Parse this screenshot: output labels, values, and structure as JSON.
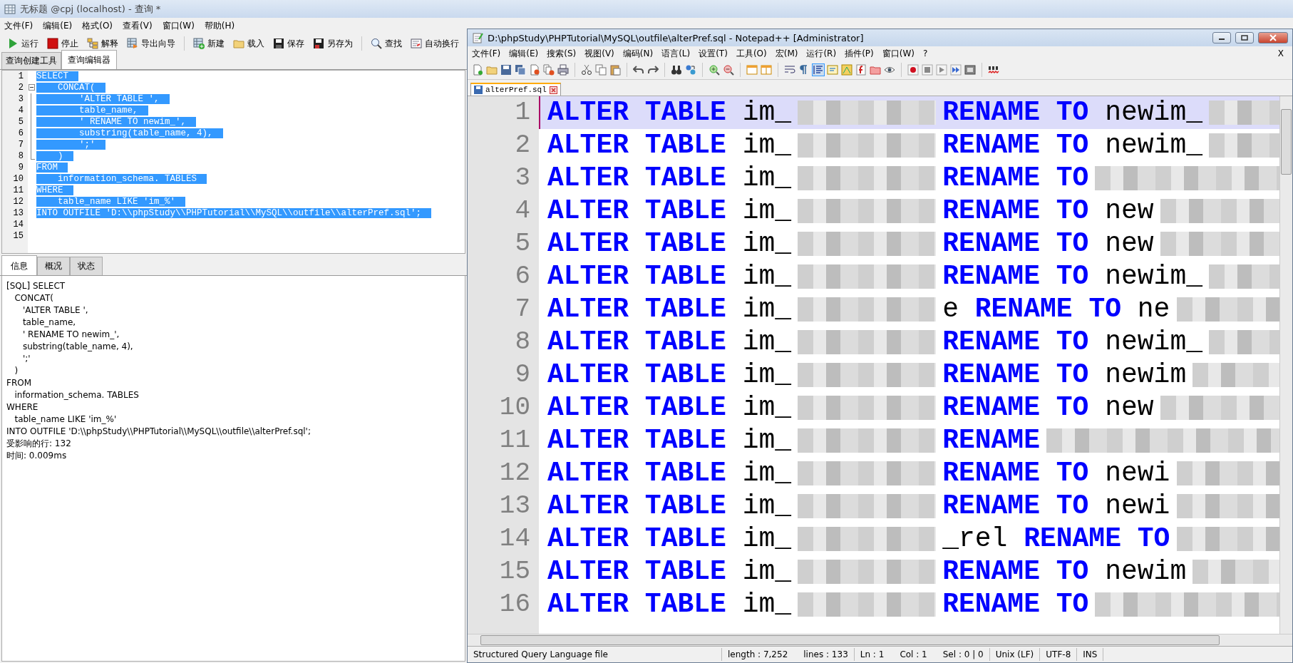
{
  "main_window": {
    "title": "无标题 @cpj (localhost) - 查询 *",
    "menu": [
      "文件(F)",
      "编辑(E)",
      "格式(O)",
      "查看(V)",
      "窗口(W)",
      "帮助(H)"
    ],
    "toolbar": [
      [
        {
          "label": "运行"
        },
        {
          "label": "停止"
        },
        {
          "label": "解释"
        },
        {
          "label": "导出向导"
        }
      ],
      [
        {
          "label": "新建"
        },
        {
          "label": "载入"
        },
        {
          "label": "保存"
        },
        {
          "label": "另存为"
        }
      ],
      [
        {
          "label": "查找"
        },
        {
          "label": "自动换行"
        }
      ]
    ],
    "tabs": [
      {
        "label": "查询创建工具",
        "selected": false
      },
      {
        "label": "查询编辑器",
        "selected": true
      }
    ],
    "editor": {
      "lines": [
        {
          "number": "1",
          "text": "SELECT",
          "selected": true,
          "kind": "plain"
        },
        {
          "number": "2",
          "text": "    CONCAT(",
          "selected": true,
          "kind": "fold_start"
        },
        {
          "number": "3",
          "text": "        'ALTER TABLE ',",
          "selected": true,
          "kind": "fold_body"
        },
        {
          "number": "4",
          "text": "        table_name,",
          "selected": true,
          "kind": "fold_body"
        },
        {
          "number": "5",
          "text": "        ' RENAME TO newim_',",
          "selected": true,
          "kind": "fold_body"
        },
        {
          "number": "6",
          "text": "        substring(table_name, 4),",
          "selected": true,
          "kind": "fold_body"
        },
        {
          "number": "7",
          "text": "        ';'",
          "selected": true,
          "kind": "fold_body"
        },
        {
          "number": "8",
          "text": "    )",
          "selected": true,
          "kind": "fold_end"
        },
        {
          "number": "9",
          "text": "FROM",
          "selected": true,
          "kind": "plain"
        },
        {
          "number": "10",
          "text": "    information_schema. TABLES",
          "selected": true,
          "kind": "plain"
        },
        {
          "number": "11",
          "text": "WHERE",
          "selected": true,
          "kind": "plain"
        },
        {
          "number": "12",
          "text": "    table_name LIKE 'im_%'",
          "selected": true,
          "kind": "plain"
        },
        {
          "number": "13",
          "text": "INTO OUTFILE 'D:\\\\phpStudy\\\\PHPTutorial\\\\MySQL\\\\outfile\\\\alterPref.sql';",
          "selected": true,
          "kind": "plain"
        },
        {
          "number": "14",
          "selected": false,
          "kind": "plain"
        },
        {
          "number": "15",
          "selected": false,
          "kind": "plain"
        }
      ]
    },
    "bottom_tabs": [
      {
        "label": "信息",
        "selected": true
      },
      {
        "label": "概况",
        "selected": false
      },
      {
        "label": "状态",
        "selected": false
      }
    ],
    "messages": [
      "[SQL] SELECT",
      "   CONCAT(",
      "      'ALTER TABLE ',",
      "      table_name,",
      "      ' RENAME TO newim_',",
      "      substring(table_name, 4),",
      "      ';'",
      "   )",
      "FROM",
      "   information_schema. TABLES",
      "WHERE",
      "   table_name LIKE 'im_%'",
      "INTO OUTFILE 'D:\\\\phpStudy\\\\PHPTutorial\\\\MySQL\\\\outfile\\\\alterPref.sql';",
      "受影响的行: 132",
      "时间: 0.009ms"
    ]
  },
  "notepad": {
    "title": "D:\\phpStudy\\PHPTutorial\\MySQL\\outfile\\alterPref.sql - Notepad++ [Administrator]",
    "menu": [
      "文件(F)",
      "编辑(E)",
      "搜索(S)",
      "视图(V)",
      "编码(N)",
      "语言(L)",
      "设置(T)",
      "工具(O)",
      "宏(M)",
      "运行(R)",
      "插件(P)",
      "窗口(W)",
      "?"
    ],
    "close_label": "X",
    "file_tab": {
      "label": "alterPref.sql"
    },
    "lines": [
      {
        "number": "1",
        "current": true,
        "keyword": "ALTER TABLE",
        "name": "im_",
        "rename": "RENAME TO",
        "after": "newim_"
      },
      {
        "number": "2",
        "current": false,
        "keyword": "ALTER TABLE",
        "name": "im_",
        "rename": "RENAME TO",
        "after": "newim_"
      },
      {
        "number": "3",
        "current": false,
        "keyword": "ALTER TABLE",
        "name": "im_",
        "rename": "RENAME TO"
      },
      {
        "number": "4",
        "current": false,
        "keyword": "ALTER TABLE",
        "name": "im_",
        "rename": "RENAME TO",
        "after": "new"
      },
      {
        "number": "5",
        "current": false,
        "keyword": "ALTER TABLE",
        "name": "im_",
        "rename": "RENAME TO",
        "after": "new"
      },
      {
        "number": "6",
        "current": false,
        "keyword": "ALTER TABLE",
        "name": "im_",
        "rename": "RENAME TO",
        "after": "newim_"
      },
      {
        "number": "7",
        "current": false,
        "keyword": "ALTER TABLE",
        "name": "im_",
        "before": "e",
        "rename": "RENAME TO",
        "after": "ne"
      },
      {
        "number": "8",
        "current": false,
        "keyword": "ALTER TABLE",
        "name": "im_",
        "rename": "RENAME TO",
        "after": "newim_"
      },
      {
        "number": "9",
        "current": false,
        "keyword": "ALTER TABLE",
        "name": "im_",
        "rename": "RENAME TO",
        "after": "newim"
      },
      {
        "number": "10",
        "current": false,
        "keyword": "ALTER TABLE",
        "name": "im_",
        "rename": "RENAME TO",
        "after": "new"
      },
      {
        "number": "11",
        "current": false,
        "keyword": "ALTER TABLE",
        "name": "im_",
        "rename": "RENAME"
      },
      {
        "number": "12",
        "current": false,
        "keyword": "ALTER TABLE",
        "name": "im_",
        "rename": "RENAME TO",
        "after": "newi"
      },
      {
        "number": "13",
        "current": false,
        "keyword": "ALTER TABLE",
        "name": "im_",
        "rename": "RENAME TO",
        "after": "newi"
      },
      {
        "number": "14",
        "current": false,
        "keyword": "ALTER TABLE",
        "name": "im_",
        "before": "_rel",
        "rename": "RENAME TO"
      },
      {
        "number": "15",
        "current": false,
        "keyword": "ALTER TABLE",
        "name": "im_",
        "rename": "RENAME TO",
        "after": "newim"
      },
      {
        "number": "16",
        "current": false,
        "keyword": "ALTER TABLE",
        "name": "im_",
        "rename": "RENAME TO"
      }
    ],
    "status_bar": [
      [
        "Structured Query Language file"
      ],
      [
        "length : 7,252",
        "lines : 133"
      ],
      [
        "Ln : 1",
        "Col : 1",
        "Sel : 0 | 0"
      ],
      [
        "Unix (LF)"
      ],
      [
        "UTF-8"
      ],
      [
        "INS"
      ]
    ]
  }
}
